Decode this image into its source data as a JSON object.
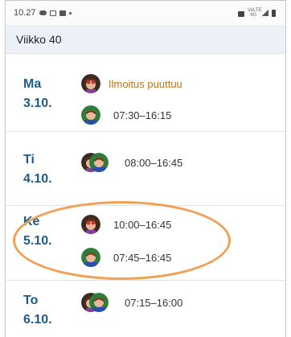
{
  "status_bar": {
    "time": "10.27",
    "network": "VoLTE 4G"
  },
  "week": {
    "title": "Viikko 40"
  },
  "days": [
    {
      "weekday": "Ma",
      "date": "3.10.",
      "entries": [
        {
          "text": "Ilmoitus puuttuu"
        },
        {
          "text": "07:30–16:15"
        }
      ]
    },
    {
      "weekday": "Ti",
      "date": "4.10.",
      "entries": [
        {
          "text": "08:00–16:45"
        }
      ]
    },
    {
      "weekday": "Ke",
      "date": "5.10.",
      "entries": [
        {
          "text": "10:00–16:45"
        },
        {
          "text": "07:45–16:45"
        }
      ]
    },
    {
      "weekday": "To",
      "date": "6.10.",
      "entries": [
        {
          "text": "07:15–16:00"
        }
      ]
    }
  ],
  "colors": {
    "day_label": "#1e5a8a",
    "warning": "#b4751a",
    "highlight": "#f0a055",
    "header_bg": "#ecf1f8"
  },
  "icons": [
    "cloud-icon",
    "image-icon",
    "message-icon",
    "lock-icon",
    "signal-icon",
    "battery-icon",
    "child-avatar-1",
    "child-avatar-2"
  ]
}
